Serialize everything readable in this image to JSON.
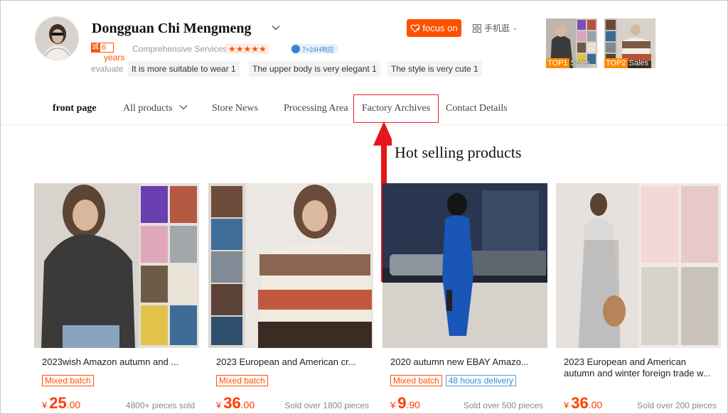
{
  "shop": {
    "name": "Dongguan Chi Mengmeng",
    "cheng_mark": "诚",
    "years_num": "6",
    "years_label": "years",
    "comprehensive_label": "Comprehensive Services",
    "rating_stars": "★★★★★",
    "response_badge": "7×24H响应",
    "focus_label": "focus on",
    "mobile_label": "手机逛"
  },
  "evaluate": {
    "label": "evaluate",
    "tags": [
      "It is more suitable to wear 1",
      "The upper body is very elegant 1",
      "The style is very cute 1"
    ]
  },
  "top_sales": [
    {
      "rank": "TOP1",
      "label": "Sales"
    },
    {
      "rank": "TOP2",
      "label": "Sales"
    }
  ],
  "nav": {
    "items": [
      "front page",
      "All products",
      "Store News",
      "Processing Area",
      "Factory Archives",
      "Contact Details"
    ]
  },
  "annotation": {
    "text": "Hot selling products"
  },
  "products": [
    {
      "title": "2023wish Amazon autumn and ...",
      "badges": [
        "Mixed batch"
      ],
      "price_symbol": "¥",
      "price_int": "25",
      "price_dec": ".00",
      "sold": "4800+ pieces sold"
    },
    {
      "title": "2023 European and American cr...",
      "badges": [
        "Mixed batch"
      ],
      "price_symbol": "¥",
      "price_int": "36",
      "price_dec": ".00",
      "sold": "Sold over 1800 pieces"
    },
    {
      "title": "2020 autumn new EBAY Amazo...",
      "badges": [
        "Mixed batch",
        "48 hours delivery"
      ],
      "price_symbol": "¥",
      "price_int": "9",
      "price_dec": ".90",
      "sold": "Sold over 500 pieces"
    },
    {
      "title": "2023 European and American autumn and winter foreign trade w...",
      "badges": [],
      "price_symbol": "¥",
      "price_int": "36",
      "price_dec": ".00",
      "sold": "Sold over 200 pieces"
    }
  ],
  "colors": {
    "accent": "#ff5000",
    "price": "#ff3d00",
    "highlight_box": "#e0242c",
    "arrow": "#e8151c",
    "info_blue": "#3a84d6"
  }
}
